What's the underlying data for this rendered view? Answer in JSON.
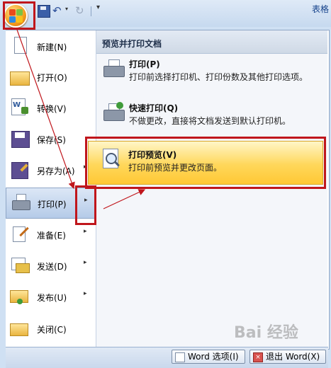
{
  "quick_access": {
    "tab_label": "表格",
    "undo_arrow": "▾",
    "customize_arrow": "▾"
  },
  "left_menu": {
    "items": [
      {
        "label": "新建(N)",
        "icon": "new-document-icon"
      },
      {
        "label": "打开(O)",
        "icon": "open-folder-icon"
      },
      {
        "label": "转换(V)",
        "icon": "convert-icon"
      },
      {
        "label": "保存(S)",
        "icon": "save-disk-icon"
      },
      {
        "label": "另存为(A)",
        "icon": "save-as-icon",
        "arrow": "▸"
      },
      {
        "label": "打印(P)",
        "icon": "printer-icon",
        "arrow": "▸"
      },
      {
        "label": "准备(E)",
        "icon": "prepare-icon",
        "arrow": "▸"
      },
      {
        "label": "发送(D)",
        "icon": "send-icon",
        "arrow": "▸"
      },
      {
        "label": "发布(U)",
        "icon": "publish-icon",
        "arrow": "▸"
      },
      {
        "label": "关闭(C)",
        "icon": "close-folder-icon"
      }
    ]
  },
  "print_panel": {
    "title": "预览并打印文档",
    "items": [
      {
        "title": "打印(P)",
        "description": "打印前选择打印机、打印份数及其他打印选项。",
        "icon": "printer-icon"
      },
      {
        "title": "快速打印(Q)",
        "description": "不做更改，直接将文档发送到默认打印机。",
        "icon": "quick-print-icon"
      },
      {
        "title": "打印预览(V)",
        "description": "打印前预览并更改页面。",
        "icon": "magnifier-icon"
      }
    ]
  },
  "bottom_bar": {
    "options_label": "Word 选项(I)",
    "exit_label": "退出 Word(X)"
  },
  "watermark": "Bai 经验",
  "colors": {
    "highlight_red": "#c0161c",
    "hover_gold": "#ffd75a",
    "menu_blue": "#cfe0f3"
  }
}
